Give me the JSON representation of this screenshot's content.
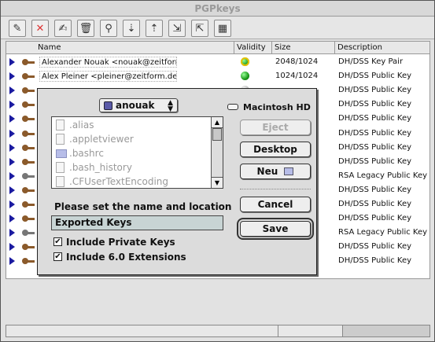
{
  "window": {
    "title": "PGPkeys"
  },
  "toolbar": {
    "buttons": [
      {
        "name": "new-key-icon",
        "glyph": "✎"
      },
      {
        "name": "revoke-icon",
        "glyph": "✕"
      },
      {
        "name": "sign-icon",
        "glyph": "✍"
      },
      {
        "name": "delete-icon",
        "glyph": "🗑"
      },
      {
        "name": "search-icon",
        "glyph": "⚲"
      },
      {
        "name": "keyserver-get-icon",
        "glyph": "⇣"
      },
      {
        "name": "keyserver-send-icon",
        "glyph": "⇡"
      },
      {
        "name": "import-icon",
        "glyph": "⇲"
      },
      {
        "name": "export-icon",
        "glyph": "⇱"
      },
      {
        "name": "save-icon",
        "glyph": "▦"
      }
    ]
  },
  "columns": {
    "name": "Name",
    "validity": "Validity",
    "size": "Size",
    "description": "Description"
  },
  "keys": [
    {
      "name": "Alexander Nouak <nouak@zeitform.de>",
      "size": "2048/1024",
      "description": "DH/DSS Key Pair",
      "validity": "pair",
      "keytype": "pair"
    },
    {
      "name": "Alex Pleiner <pleiner@zeitform.de>",
      "size": "1024/1024",
      "description": "DH/DSS Public Key",
      "validity": "valid",
      "keytype": "dh"
    },
    {
      "name": "",
      "size": "",
      "description": "DH/DSS Public Key",
      "validity": "gray",
      "keytype": "dh"
    },
    {
      "name": "",
      "size": "",
      "description": "DH/DSS Public Key",
      "validity": "",
      "keytype": "dh"
    },
    {
      "name": "",
      "size": "",
      "description": "DH/DSS Public Key",
      "validity": "",
      "keytype": "dh"
    },
    {
      "name": "",
      "size": "",
      "description": "DH/DSS Public Key",
      "validity": "",
      "keytype": "dh"
    },
    {
      "name": "",
      "size": "",
      "description": "DH/DSS Public Key",
      "validity": "",
      "keytype": "dh"
    },
    {
      "name": "",
      "size": "",
      "description": "DH/DSS Public Key",
      "validity": "",
      "keytype": "dh"
    },
    {
      "name": "",
      "size": "",
      "description": "RSA Legacy Public Key",
      "validity": "",
      "keytype": "rsa"
    },
    {
      "name": "",
      "size": "",
      "description": "DH/DSS Public Key",
      "validity": "",
      "keytype": "dh"
    },
    {
      "name": "",
      "size": "",
      "description": "DH/DSS Public Key",
      "validity": "",
      "keytype": "dh"
    },
    {
      "name": "",
      "size": "",
      "description": "DH/DSS Public Key",
      "validity": "",
      "keytype": "dh"
    },
    {
      "name": "",
      "size": "",
      "description": "RSA Legacy Public Key",
      "validity": "",
      "keytype": "rsa"
    },
    {
      "name": "",
      "size": "",
      "description": "DH/DSS Public Key",
      "validity": "",
      "keytype": "dh"
    },
    {
      "name": "",
      "size": "",
      "description": "DH/DSS Public Key",
      "validity": "",
      "keytype": "dh"
    }
  ],
  "dialog": {
    "folder_popup": "anouak",
    "volume": "Macintosh HD",
    "files": [
      {
        "name": ".alias",
        "kind": "file"
      },
      {
        "name": ".appletviewer",
        "kind": "file"
      },
      {
        "name": ".bashrc",
        "kind": "folder"
      },
      {
        "name": ".bash_history",
        "kind": "file"
      },
      {
        "name": ".CFUserTextEncoding",
        "kind": "file"
      }
    ],
    "eject_label": "Eject",
    "desktop_label": "Desktop",
    "new_label": "Neu",
    "cancel_label": "Cancel",
    "save_label": "Save",
    "prompt": "Please set the name and location",
    "filename": "Exported Keys",
    "include_private_label": "Include Private Keys",
    "include_private_checked": true,
    "include_60_label": "Include 6.0 Extensions",
    "include_60_checked": true
  }
}
